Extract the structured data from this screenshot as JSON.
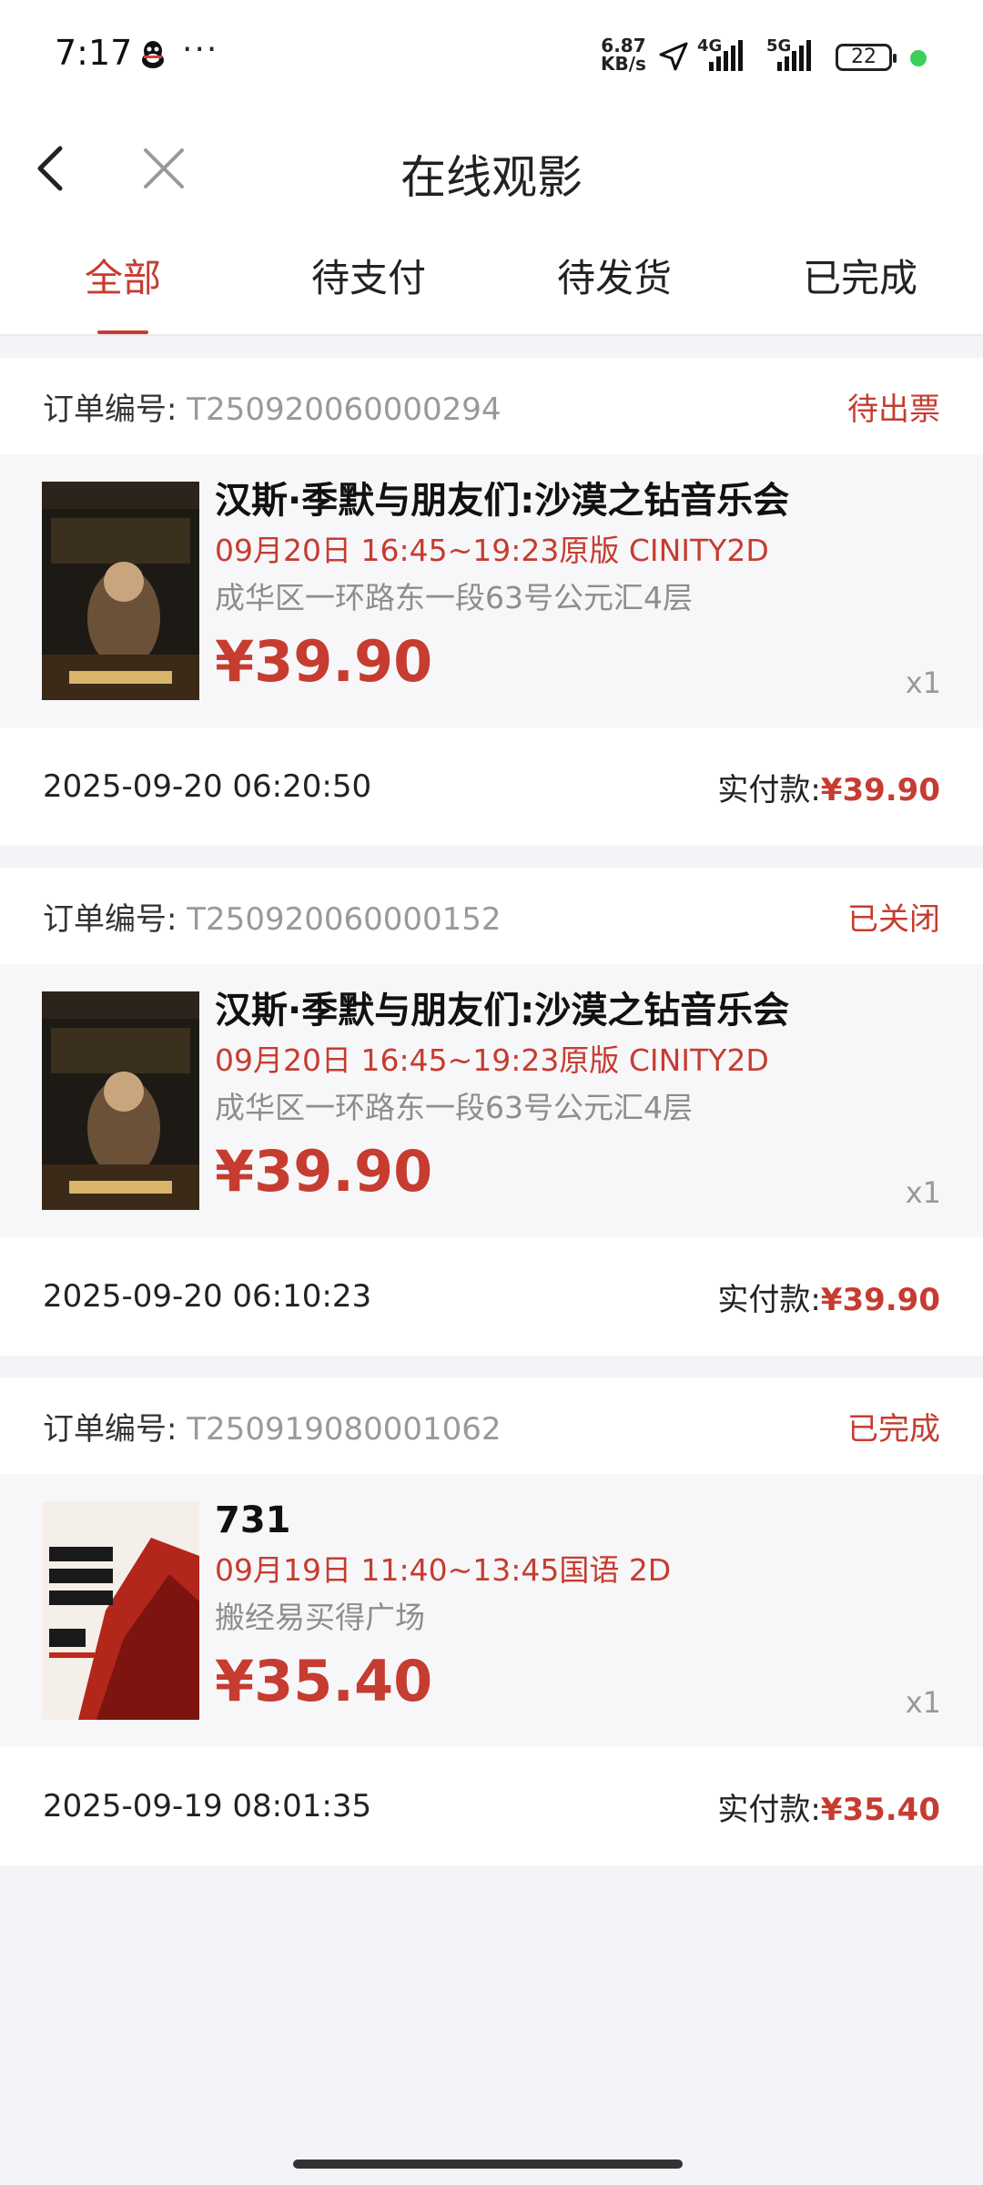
{
  "status_bar": {
    "time": "7:17",
    "speed_top": "6.87",
    "speed_bottom": "KB/s",
    "net1": "4G",
    "net2": "5G",
    "battery": "22"
  },
  "nav": {
    "title": "在线观影"
  },
  "tabs": [
    {
      "label": "全部",
      "active": true
    },
    {
      "label": "待支付"
    },
    {
      "label": "待发货"
    },
    {
      "label": "已完成"
    }
  ],
  "orders": [
    {
      "label": "订单编号:",
      "number": "T250920060000294",
      "status": "待出票",
      "title": "汉斯·季默与朋友们:沙漠之钻音乐会",
      "show": "09月20日 16:45~19:23原版 CINITY2D",
      "address": "成华区一环路东一段63号公元汇4层",
      "price": "¥39.90",
      "qty": "x1",
      "time": "2025-09-20 06:20:50",
      "paid_label": "实付款:",
      "paid": "¥39.90"
    },
    {
      "label": "订单编号:",
      "number": "T250920060000152",
      "status": "已关闭",
      "title": "汉斯·季默与朋友们:沙漠之钻音乐会",
      "show": "09月20日 16:45~19:23原版 CINITY2D",
      "address": "成华区一环路东一段63号公元汇4层",
      "price": "¥39.90",
      "qty": "x1",
      "time": "2025-09-20 06:10:23",
      "paid_label": "实付款:",
      "paid": "¥39.90"
    },
    {
      "label": "订单编号:",
      "number": "T250919080001062",
      "status": "已完成",
      "title": "731",
      "show": "09月19日 11:40~13:45国语 2D",
      "address": "搬经易买得广场",
      "price": "¥35.40",
      "qty": "x1",
      "time": "2025-09-19 08:01:35",
      "paid_label": "实付款:",
      "paid": "¥35.40"
    }
  ],
  "colors": {
    "accent": "#c63c30",
    "bg": "#f3f4f8"
  }
}
